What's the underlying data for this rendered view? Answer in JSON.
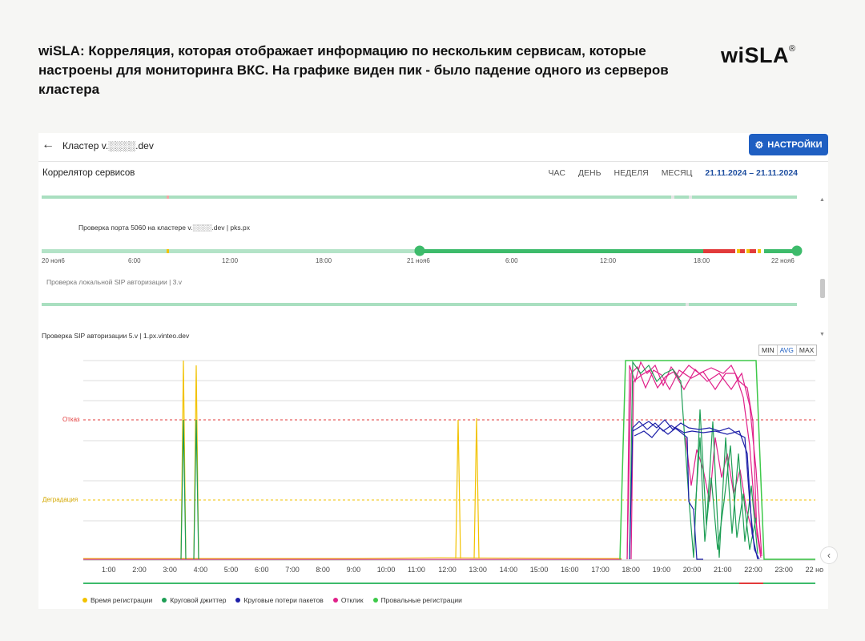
{
  "headline": "wiSLA: Корреляция, которая отображает информацию по нескольким сервисам, которые настроены для мониторинга ВКС. На графике виден пик - было падение одного из серверов кластера",
  "logo_text": "wiSLA",
  "logo_mark": "®",
  "app": {
    "cluster_title": "Кластер v.░░░░.dev",
    "settings_label": "НАСТРОЙКИ",
    "correlator_title": "Коррелятор сервисов",
    "periods": [
      "ЧАС",
      "ДЕНЬ",
      "НЕДЕЛЯ",
      "МЕСЯЦ"
    ],
    "date_range": "21.11.2024 – 21.11.2024"
  },
  "services": {
    "port_check": "Проверка порта 5060 на кластере v.░░░░.dev | pks.px",
    "local_sip": "Проверка локальной SIP авторизации | 3.v",
    "sip_auth": "Проверка SIP авторизации 5.v | 1.px.vinteo.dev"
  },
  "timeline_ticks": [
    "20 ноя6",
    "6:00",
    "12:00",
    "18:00",
    "21 ноя6",
    "6:00",
    "12:00",
    "18:00",
    "22 ноя6"
  ],
  "colors": {
    "accent": "#1f5fc2",
    "ok": "#3dbb6b",
    "ok_light": "#a9dfc0",
    "fail": "#e23b3b",
    "degrade": "#f2c200"
  },
  "chart_data": {
    "type": "line",
    "title": "",
    "xlabel": "",
    "ylabel": "",
    "x": [
      "1:00",
      "2:00",
      "3:00",
      "4:00",
      "5:00",
      "6:00",
      "7:00",
      "8:00",
      "9:00",
      "10:00",
      "11:00",
      "12:00",
      "13:00",
      "14:00",
      "15:00",
      "16:00",
      "17:00",
      "18:00",
      "19:00",
      "20:00",
      "21:00",
      "22:00",
      "23:00",
      "22 но"
    ],
    "thresholds": [
      {
        "name": "Отказ",
        "color": "#e23b3b"
      },
      {
        "name": "Деградация",
        "color": "#f2c200"
      }
    ],
    "modes": [
      "MIN",
      "AVG",
      "MAX"
    ],
    "active_mode": "AVG",
    "legend_position": "bottom",
    "series": [
      {
        "name": "Время регистрации",
        "color": "#f2c200"
      },
      {
        "name": "Круговой джиттер",
        "color": "#1e9e55"
      },
      {
        "name": "Круговые потери пакетов",
        "color": "#1d1fa8"
      },
      {
        "name": "Отклик",
        "color": "#e0218a"
      },
      {
        "name": "Провальные регистрации",
        "color": "#3ec94a"
      }
    ]
  }
}
